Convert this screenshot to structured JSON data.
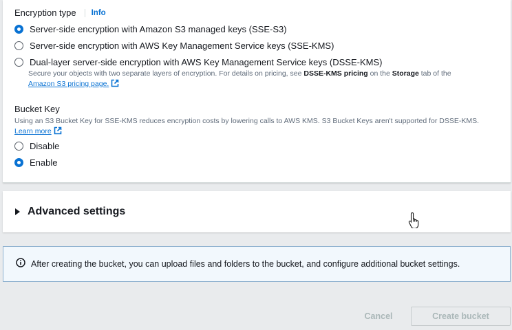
{
  "encryption": {
    "label": "Encryption type",
    "info": "Info",
    "options": [
      {
        "label": "Server-side encryption with Amazon S3 managed keys (SSE-S3)",
        "checked": true
      },
      {
        "label": "Server-side encryption with AWS Key Management Service keys (SSE-KMS)",
        "checked": false
      },
      {
        "label": "Dual-layer server-side encryption with AWS Key Management Service keys (DSSE-KMS)",
        "checked": false
      }
    ],
    "dsse_desc_pre": "Secure your objects with two separate layers of encryption. For details on pricing, see ",
    "dsse_desc_b1": "DSSE-KMS pricing",
    "dsse_desc_mid": " on the ",
    "dsse_desc_b2": "Storage",
    "dsse_desc_post": " tab of the",
    "pricing_link": "Amazon S3 pricing page."
  },
  "bucket_key": {
    "label": "Bucket Key",
    "desc": "Using an S3 Bucket Key for SSE-KMS reduces encryption costs by lowering calls to AWS KMS. S3 Bucket Keys aren't supported for DSSE-KMS.",
    "learn_more": "Learn more",
    "options": [
      {
        "label": "Disable",
        "checked": false
      },
      {
        "label": "Enable",
        "checked": true
      }
    ]
  },
  "advanced": {
    "title": "Advanced settings"
  },
  "alert": {
    "text": "After creating the bucket, you can upload files and folders to the bucket, and configure additional bucket settings."
  },
  "footer": {
    "cancel": "Cancel",
    "create": "Create bucket"
  },
  "colors": {
    "accent": "#0972d3",
    "disabled_text": "#aab7b8",
    "alert_bg": "#f2f8fd"
  }
}
